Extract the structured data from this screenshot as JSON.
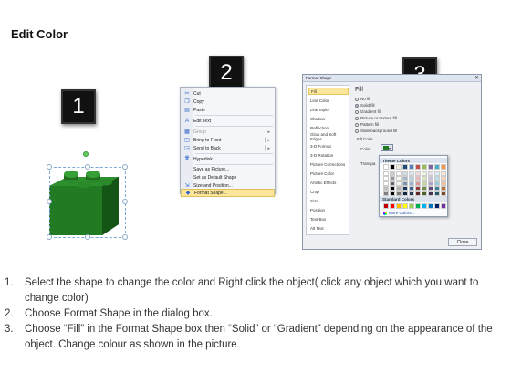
{
  "title": "Edit Color",
  "steps": [
    "1",
    "2",
    "3"
  ],
  "context_menu": {
    "items": [
      {
        "icon": "scissors-icon",
        "label": "Cut"
      },
      {
        "icon": "copy-icon",
        "label": "Copy"
      },
      {
        "icon": "paste-icon",
        "label": "Paste"
      },
      {
        "icon": "edit-text-icon",
        "label": "Edit Text"
      },
      {
        "icon": "group-icon",
        "label": "Group",
        "disabled": true
      },
      {
        "icon": "bring-to-front-icon",
        "label": "Bring to Front"
      },
      {
        "icon": "send-to-back-icon",
        "label": "Send to Back"
      },
      {
        "icon": "hyperlink-icon",
        "label": "Hyperlink..."
      },
      {
        "icon": "save-picture-icon",
        "label": "Save as Picture..."
      },
      {
        "icon": "default-shape-icon",
        "label": "Set as Default Shape"
      },
      {
        "icon": "size-position-icon",
        "label": "Size and Position..."
      },
      {
        "icon": "format-shape-icon",
        "label": "Format Shape...",
        "highlighted": true
      }
    ]
  },
  "dialog": {
    "title": "Format Shape",
    "close_x": "✕",
    "categories": [
      "Fill",
      "Line Color",
      "Line Style",
      "Shadow",
      "Reflection",
      "Glow and Soft Edges",
      "3-D Format",
      "3-D Rotation",
      "Picture Corrections",
      "Picture Color",
      "Artistic Effects",
      "Crop",
      "Size",
      "Position",
      "Text Box",
      "Alt Text"
    ],
    "selected_category": "Fill",
    "heading": "Fill",
    "options": [
      "No fill",
      "Solid fill",
      "Gradient fill",
      "Picture or texture fill",
      "Pattern fill",
      "Slide background fill"
    ],
    "selected_option": "Solid fill",
    "fill_color_label": "Fill Color",
    "color_label": "Color:",
    "transparency_label": "Transpa",
    "close_button": "Close"
  },
  "palette": {
    "theme_colors_label": "Theme Colors",
    "standard_colors_label": "Standard Colors",
    "more_colors_label": "More Colors...",
    "theme_colors": [
      "#ffffff",
      "#000000",
      "#eeece1",
      "#1f497d",
      "#4f81bd",
      "#c0504d",
      "#9bbb59",
      "#8064a2",
      "#4bacc6",
      "#f79646"
    ],
    "standard_colors": [
      "#c00000",
      "#ff0000",
      "#ffc000",
      "#ffff00",
      "#92d050",
      "#00b050",
      "#00b0f0",
      "#0070c0",
      "#002060",
      "#7030a0"
    ]
  },
  "instructions": [
    {
      "num": "1.",
      "text": "Select the shape to change the color and Right click the object( click any object which you want to change color)"
    },
    {
      "num": "2.",
      "text": "Choose Format Shape in the dialog box."
    },
    {
      "num": "3.",
      "text": "Choose “Fill” in the Format Shape box then “Solid” or “Gradient” depending on the appearance of the object. Change colour as shown in the picture."
    }
  ]
}
